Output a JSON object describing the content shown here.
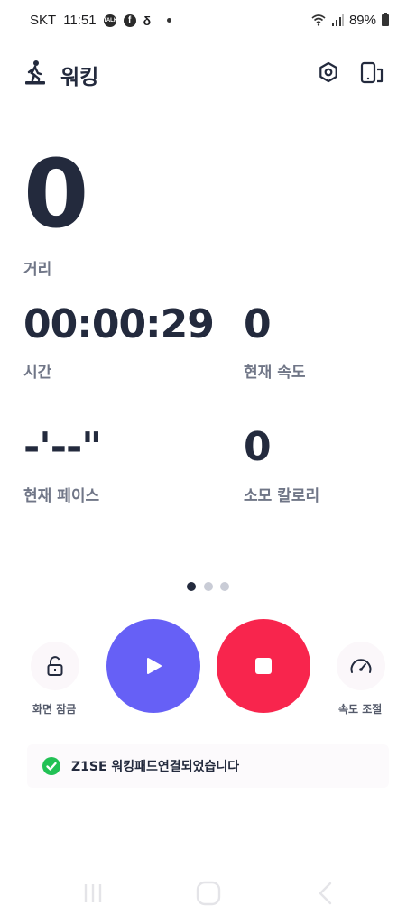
{
  "status_bar": {
    "carrier": "SKT",
    "time": "11:51",
    "notif_talk": "TALK",
    "battery": "89%"
  },
  "header": {
    "title": "워킹",
    "icon": "walking-person-icon",
    "settings_icon": "gear-icon",
    "device_icon": "device-link-icon"
  },
  "metrics": {
    "distance": {
      "value": "0",
      "label": "거리"
    },
    "time": {
      "value": "00:00:29",
      "label": "시간"
    },
    "speed": {
      "value": "0",
      "label": "현재 속도"
    },
    "pace": {
      "value": "-'--\"",
      "label": "현재 페이스"
    },
    "calories": {
      "value": "0",
      "label": "소모 칼로리"
    }
  },
  "pager": {
    "pages": 3,
    "active": 0
  },
  "controls": {
    "lock_label": "화면 잠금",
    "speed_label": "속도 조절",
    "play_color": "#6660f6",
    "stop_color": "#f8254d"
  },
  "connection": {
    "message": "Z1SE 워킹패드연결되었습니다",
    "status_color": "#22c155"
  }
}
